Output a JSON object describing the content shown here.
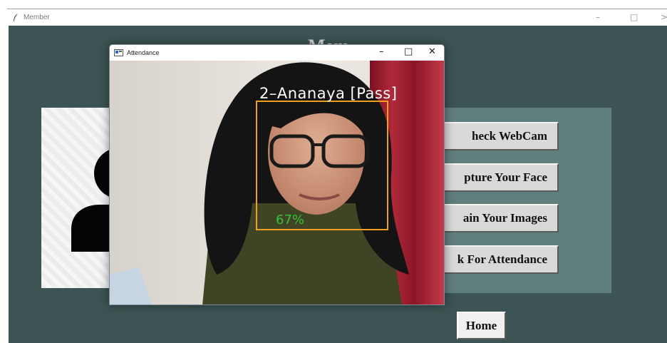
{
  "main_window": {
    "title": "Member",
    "minimize_glyph": "–",
    "maximize_glyph": "□",
    "close_glyph": ">",
    "heading_partial": "Mem"
  },
  "buttons": {
    "check_webcam": "heck WebCam",
    "capture_face": "pture Your Face",
    "train_images": "ain Your Images",
    "check_attendance": "k For Attendance",
    "home": "Home"
  },
  "attendance_window": {
    "title": "Attendance",
    "minimize_glyph": "–",
    "maximize_glyph": "□",
    "close_glyph": "✕",
    "face_label": "2–Ananaya [Pass]",
    "confidence": "67%",
    "box_color": "#f0a020"
  },
  "icons": {
    "app_icon": "feather-icon",
    "avatar": "user-silhouette-icon",
    "attendance_app_icon": "window-app-icon"
  },
  "colors": {
    "window_bg": "#3c5453",
    "button_panel_bg": "#5f7f7d",
    "button_face": "#d9d9d9",
    "label_text": "#ffffff",
    "confidence_text": "#38c238"
  }
}
